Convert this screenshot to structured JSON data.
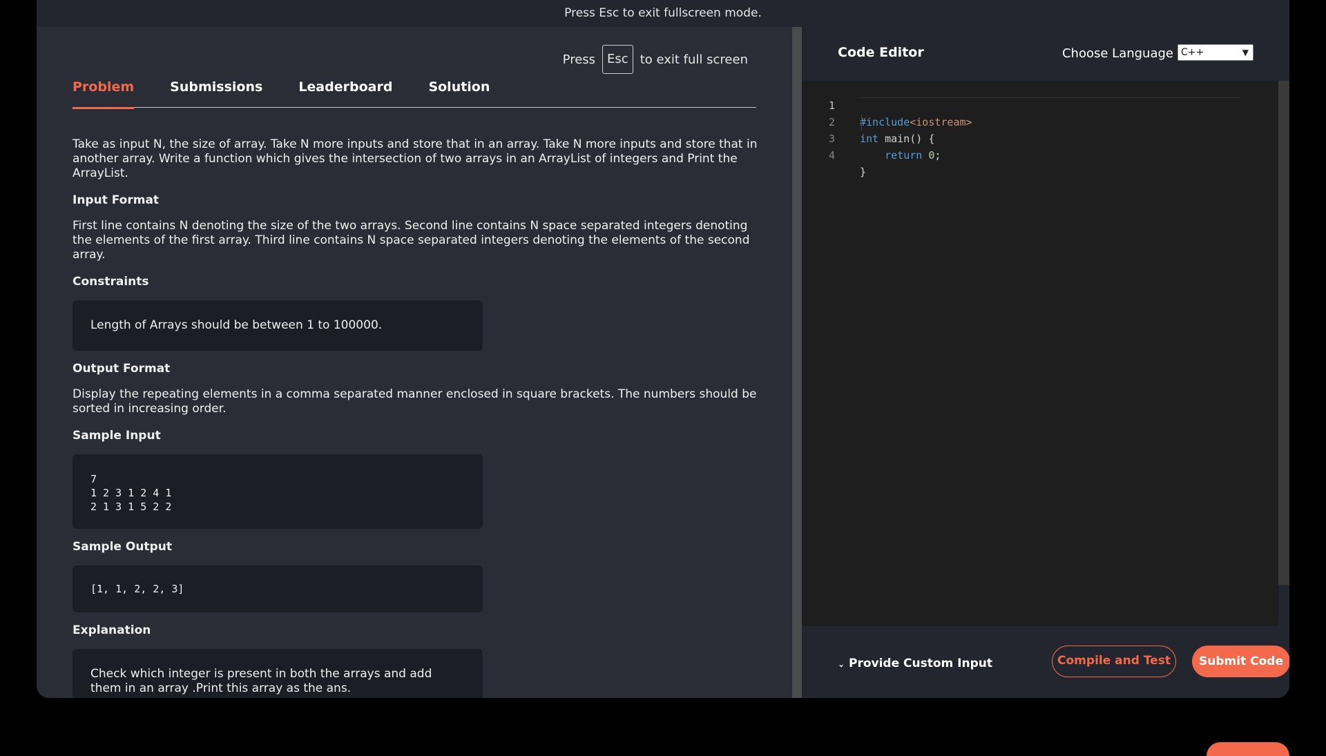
{
  "fullscreen_banner": "Press Esc to exit fullscreen mode.",
  "esc_hint": {
    "press": "Press",
    "key": "Esc",
    "suffix": "to exit full screen"
  },
  "tabs": [
    {
      "label": "Problem",
      "active": true
    },
    {
      "label": "Submissions",
      "active": false
    },
    {
      "label": "Leaderboard",
      "active": false
    },
    {
      "label": "Solution",
      "active": false
    }
  ],
  "problem": {
    "description": "Take as input N, the size of array. Take N more inputs and store that in an array. Take N more inputs and store that in another array. Write a function which gives the intersection of two arrays in an ArrayList of integers and Print the ArrayList.",
    "input_format_heading": "Input Format",
    "input_format": "First line contains N denoting the size of the two arrays. Second line contains N space separated integers denoting the elements of the first array. Third line contains N space separated integers denoting the elements of the second array.",
    "constraints_heading": "Constraints",
    "constraints": "Length of Arrays should be between 1 to 100000.",
    "output_format_heading": "Output Format",
    "output_format": "Display the repeating elements in a comma separated manner enclosed in square brackets. The numbers should be sorted in increasing order.",
    "sample_input_heading": "Sample Input",
    "sample_input": "7\n1 2 3 1 2 4 1\n2 1 3 1 5 2 2",
    "sample_output_heading": "Sample Output",
    "sample_output": "[1, 1, 2, 2, 3]",
    "explanation_heading": "Explanation",
    "explanation": "Check which integer is present in both the arrays and add them in an array .Print this array as the ans."
  },
  "editor": {
    "title": "Code Editor",
    "language_label": "Choose Language",
    "language_selected": "C++",
    "code_lines": [
      {
        "number": "1",
        "text": "#include<iostream>"
      },
      {
        "number": "2",
        "text": "int main() {"
      },
      {
        "number": "3",
        "text": "    return 0;"
      },
      {
        "number": "4",
        "text": "}"
      }
    ]
  },
  "footer": {
    "custom_input_label": "Provide Custom Input",
    "compile_label": "Compile and Test",
    "submit_label": "Submit Code"
  },
  "colors": {
    "accent": "#f26a4b",
    "background": "#2a2d36",
    "editor_bg": "#1e1e1e"
  },
  "icons": {
    "custom_input_toggle": "chevron-down-icon",
    "language_dropdown": "chevron-down-icon"
  }
}
